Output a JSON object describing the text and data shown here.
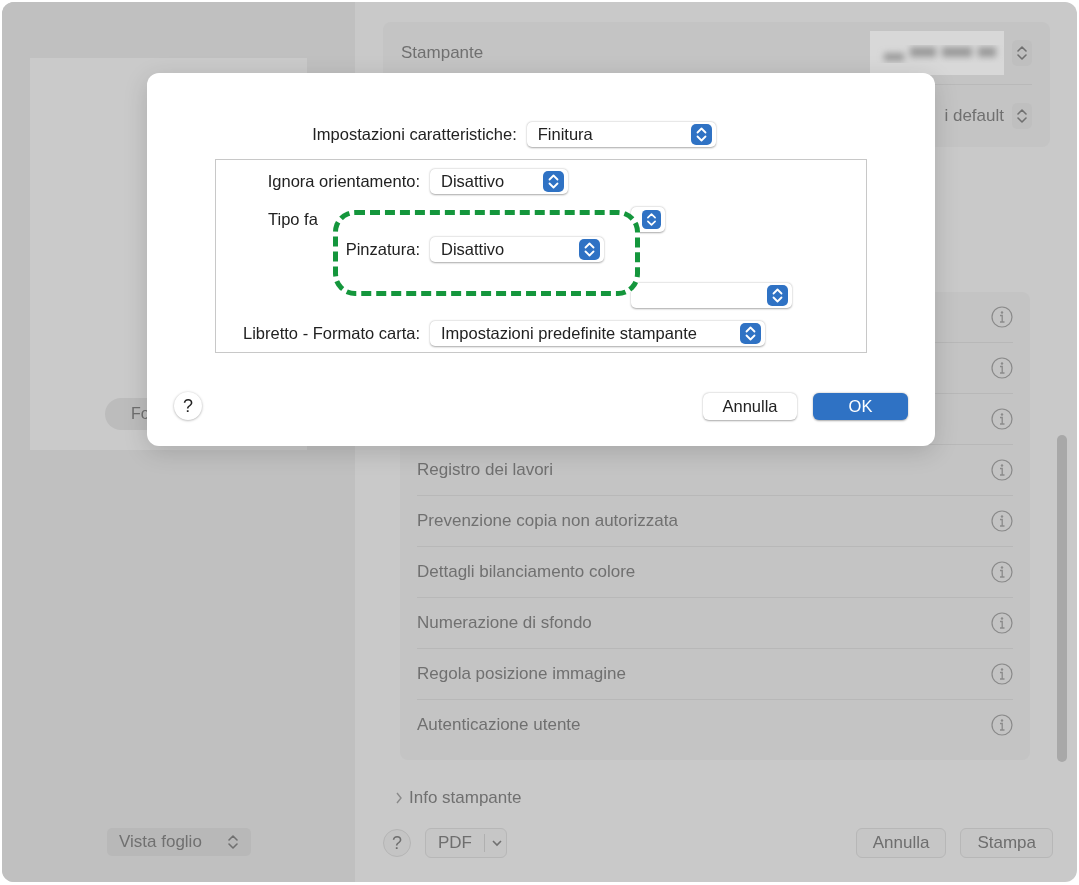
{
  "print_window": {
    "preview": {
      "button_label": "Fo"
    },
    "printer": {
      "label": "Stampante"
    },
    "presets": {
      "value": "i default"
    },
    "options": [
      {
        "kind": "covered"
      },
      {
        "kind": "covered"
      },
      {
        "kind": "covered"
      },
      {
        "kind": "text",
        "label": "Registro dei lavori"
      },
      {
        "kind": "text",
        "label": "Prevenzione copia non autorizzata"
      },
      {
        "kind": "text",
        "label": "Dettagli bilanciamento colore"
      },
      {
        "kind": "text",
        "label": "Numerazione di sfondo"
      },
      {
        "kind": "text",
        "label": "Regola posizione immagine"
      },
      {
        "kind": "text",
        "label": "Autenticazione utente"
      }
    ],
    "info_section": {
      "label": "Info stampante",
      "expanded": false
    },
    "footer": {
      "view_select": "Vista foglio",
      "help": "?",
      "pdf": "PDF",
      "cancel": "Annulla",
      "print": "Stampa"
    }
  },
  "dialog": {
    "feature_label": "Impostazioni caratteristiche:",
    "feature_value": "Finitura",
    "settings": [
      {
        "kind": "full",
        "label": "Ignora orientamento:",
        "value": "Disattivo"
      },
      {
        "kind": "label_only",
        "label": "Tipo fa"
      },
      {
        "kind": "covered"
      },
      {
        "kind": "popup_only"
      },
      {
        "kind": "full",
        "label": "Libretto - Formato carta:",
        "value": "Impostazioni predefinite stampante"
      }
    ],
    "callout": {
      "label": "Pinzatura:",
      "value": "Disattivo"
    },
    "help": "?",
    "cancel": "Annulla",
    "ok": "OK"
  }
}
